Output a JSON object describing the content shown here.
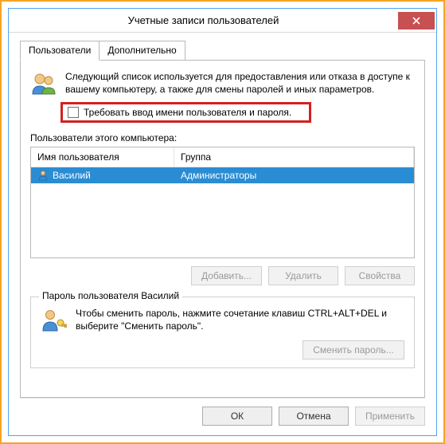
{
  "window": {
    "title": "Учетные записи пользователей"
  },
  "tabs": {
    "users": "Пользователи",
    "advanced": "Дополнительно"
  },
  "intro": {
    "text": "Следующий список используется для предоставления или отказа в доступе к вашему компьютеру, а также для смены паролей и иных параметров."
  },
  "require_credentials": {
    "label": "Требовать ввод имени пользователя и пароля.",
    "checked": false
  },
  "list_caption": "Пользователи этого компьютера:",
  "columns": {
    "username": "Имя пользователя",
    "group": "Группа"
  },
  "users": [
    {
      "username": "Василий",
      "group": "Администраторы",
      "selected": true
    }
  ],
  "list_buttons": {
    "add": "Добавить...",
    "remove": "Удалить",
    "properties": "Свойства"
  },
  "password_group": {
    "title": "Пароль пользователя Василий",
    "text": "Чтобы сменить пароль, нажмите сочетание клавиш CTRL+ALT+DEL и выберите \"Сменить пароль\".",
    "button": "Сменить пароль..."
  },
  "dialog_buttons": {
    "ok": "ОК",
    "cancel": "Отмена",
    "apply": "Применить"
  }
}
